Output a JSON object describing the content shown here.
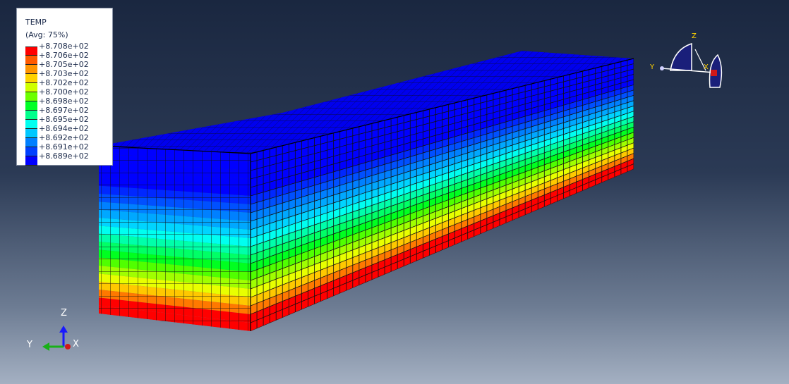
{
  "legend": {
    "title": "TEMP",
    "subtitle": "(Avg: 75%)",
    "labels": [
      "+8.708e+02",
      "+8.706e+02",
      "+8.705e+02",
      "+8.703e+02",
      "+8.702e+02",
      "+8.700e+02",
      "+8.698e+02",
      "+8.697e+02",
      "+8.695e+02",
      "+8.694e+02",
      "+8.692e+02",
      "+8.691e+02",
      "+8.689e+02"
    ],
    "colors": [
      "#ff0000",
      "#ff5a00",
      "#ff9400",
      "#ffd200",
      "#d0ff00",
      "#6cff00",
      "#00ff26",
      "#00ff8c",
      "#00fff0",
      "#00c8ff",
      "#0080ff",
      "#0040ff",
      "#0000ff"
    ]
  },
  "triad": {
    "z": "Z",
    "y": "Y",
    "x": "X"
  },
  "view_cube": {
    "z": "Z",
    "y": "Y",
    "x": "X"
  },
  "model": {
    "field": "TEMP",
    "bands_top_to_bottom": [
      "#0000ff",
      "#0000ff",
      "#0000ff",
      "#0000ff",
      "#0000ff",
      "#0028ff",
      "#0050ff",
      "#0080ff",
      "#00a8ff",
      "#00d4ff",
      "#00fff0",
      "#00ffaa",
      "#00ff66",
      "#00ff20",
      "#50ff00",
      "#a0ff00",
      "#e8ff00",
      "#ffc800",
      "#ff7800",
      "#ff0000",
      "#ff0000"
    ]
  }
}
